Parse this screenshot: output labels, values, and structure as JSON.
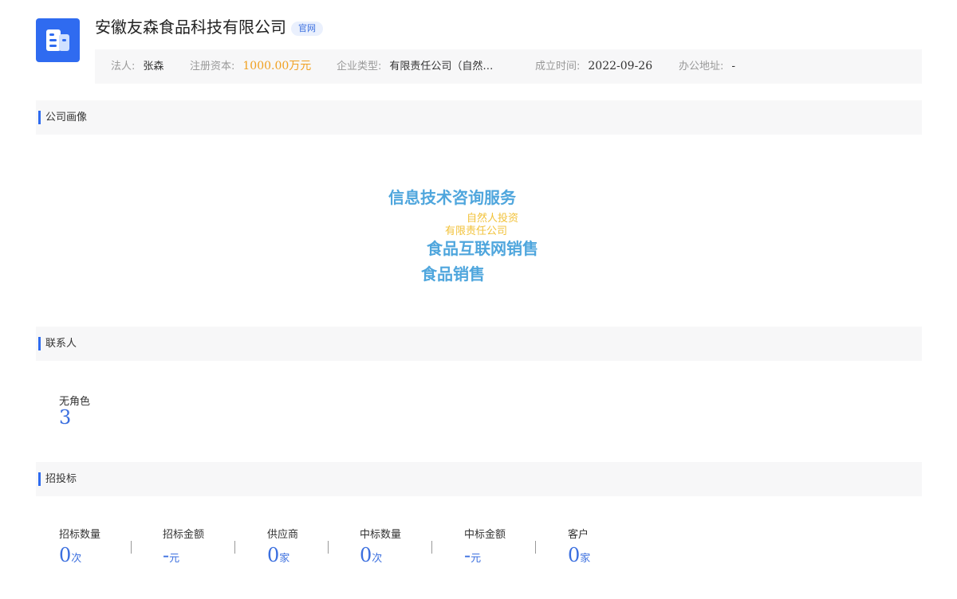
{
  "company": {
    "name": "安徽友森食品科技有限公司",
    "official_tag": "官网",
    "logo_icon": "building-icon",
    "accent_color": "#2f6bf0"
  },
  "info": {
    "legal_person_label": "法人:",
    "legal_person_value": "张森",
    "capital_label": "注册资本:",
    "capital_value": "1000.00万元",
    "type_label": "企业类型:",
    "type_value": "有限责任公司（自然人投资或控股）",
    "established_label": "成立时间:",
    "established_value": "2022-09-26",
    "address_label": "办公地址:",
    "address_value": "-"
  },
  "sections": {
    "portrait": "公司画像",
    "contacts": "联系人",
    "bidding": "招投标"
  },
  "word_cloud": [
    {
      "text": "信息技术咨询服务",
      "color": "#4fa6dd"
    },
    {
      "text": "自然人投资",
      "color": "#f2c23a"
    },
    {
      "text": "有限责任公司",
      "color": "#f2c23a"
    },
    {
      "text": "食品互联网销售",
      "color": "#4fa6dd"
    },
    {
      "text": "食品销售",
      "color": "#4fa6dd"
    }
  ],
  "contacts": {
    "label": "无角色",
    "count": "3"
  },
  "bidding": {
    "stats": [
      {
        "label": "招标数量",
        "value": "0",
        "unit": "次"
      },
      {
        "label": "招标金额",
        "value": "-",
        "unit": "元"
      },
      {
        "label": "供应商",
        "value": "0",
        "unit": "家"
      },
      {
        "label": "中标数量",
        "value": "0",
        "unit": "次"
      },
      {
        "label": "中标金额",
        "value": "-",
        "unit": "元"
      },
      {
        "label": "客户",
        "value": "0",
        "unit": "家"
      }
    ]
  }
}
